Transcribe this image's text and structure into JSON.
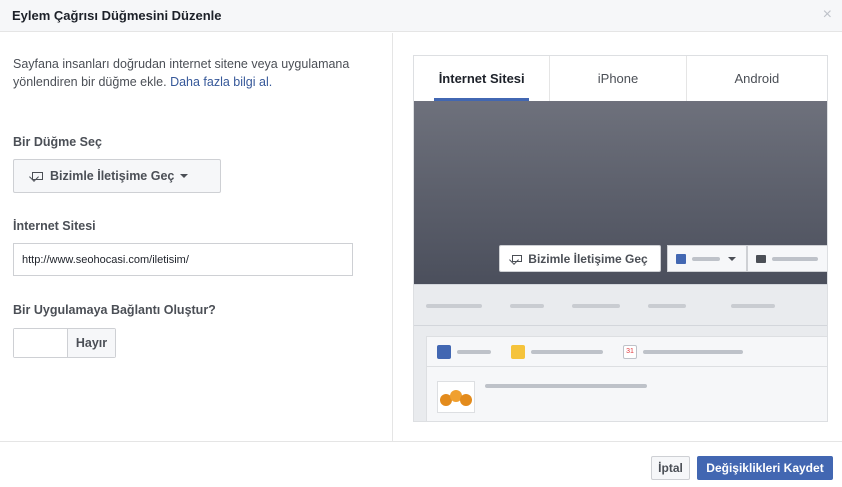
{
  "dialog": {
    "title": "Eylem Çağrısı Düğmesini Düzenle",
    "close_icon": "close-icon"
  },
  "form": {
    "description": "Sayfana insanları doğrudan internet sitene veya uygulamana yönlendiren bir düğme ekle.",
    "learn_more": "Daha fazla bilgi al.",
    "choose_button_label": "Bir Düğme Seç",
    "choose_button_value": "Bizimle İletişime Geç",
    "website_label": "İnternet Sitesi",
    "website_value": "http://www.seohocasi.com/iletisim/",
    "app_link_label": "Bir Uygulamaya Bağlantı Oluştur?",
    "app_link_toggle": "Hayır"
  },
  "preview": {
    "tabs": [
      "İnternet Sitesi",
      "iPhone",
      "Android"
    ],
    "active_tab": "İnternet Sitesi",
    "cta_label": "Bizimle İletişime Geç",
    "date_icon_text": "31"
  },
  "footer": {
    "cancel_label": "İptal",
    "save_label": "Değişiklikleri Kaydet"
  },
  "colors": {
    "accent": "#4267b2",
    "link": "#365899",
    "cover_top": "#6e717c",
    "cover_bottom": "#4b4f5c"
  }
}
